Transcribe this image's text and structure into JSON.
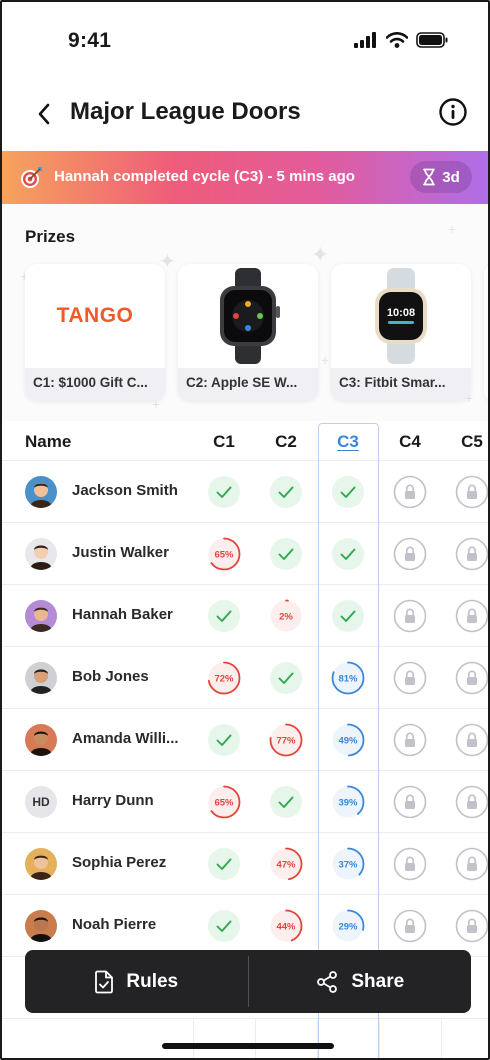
{
  "status_bar": {
    "time": "9:41"
  },
  "header": {
    "title": "Major League Doors"
  },
  "banner": {
    "text": "Hannah completed cycle (C3) - 5 mins ago",
    "timer": "3d"
  },
  "prizes": {
    "title": "Prizes",
    "items": [
      {
        "label": "C1: $1000 Gift C...",
        "image": "tango-logo",
        "logo_text": "TANGO"
      },
      {
        "label": "C2: Apple SE W...",
        "image": "apple-watch"
      },
      {
        "label": "C3: Fitbit Smar...",
        "image": "fitbit-watch"
      }
    ]
  },
  "table": {
    "name_header": "Name",
    "columns": [
      "C1",
      "C2",
      "C3",
      "C4",
      "C5"
    ],
    "active_column": "C3",
    "rows": [
      {
        "name": "Jackson Smith",
        "cells": [
          "done",
          "done",
          "done",
          "locked",
          "locked"
        ]
      },
      {
        "name": "Justin Walker",
        "cells": [
          "65%",
          "done",
          "done",
          "locked",
          "locked"
        ]
      },
      {
        "name": "Hannah Baker",
        "cells": [
          "done",
          "2%",
          "done",
          "locked",
          "locked"
        ]
      },
      {
        "name": "Bob Jones",
        "cells": [
          "72%",
          "done",
          "81%",
          "locked",
          "locked"
        ]
      },
      {
        "name": "Amanda Willi...",
        "cells": [
          "done",
          "77%",
          "49%",
          "locked",
          "locked"
        ]
      },
      {
        "name": "Harry Dunn",
        "initials": "HD",
        "cells": [
          "65%",
          "done",
          "39%",
          "locked",
          "locked"
        ]
      },
      {
        "name": "Sophia Perez",
        "cells": [
          "done",
          "47%",
          "37%",
          "locked",
          "locked"
        ]
      },
      {
        "name": "Noah Pierre",
        "cells": [
          "done",
          "44%",
          "29%",
          "locked",
          "locked"
        ]
      }
    ]
  },
  "footer": {
    "rules_label": "Rules",
    "share_label": "Share"
  },
  "colors": {
    "done": "#2fa84f",
    "partial_red": "#e0453a",
    "partial_blue": "#3a86d9",
    "locked": "#c2c2ca"
  }
}
